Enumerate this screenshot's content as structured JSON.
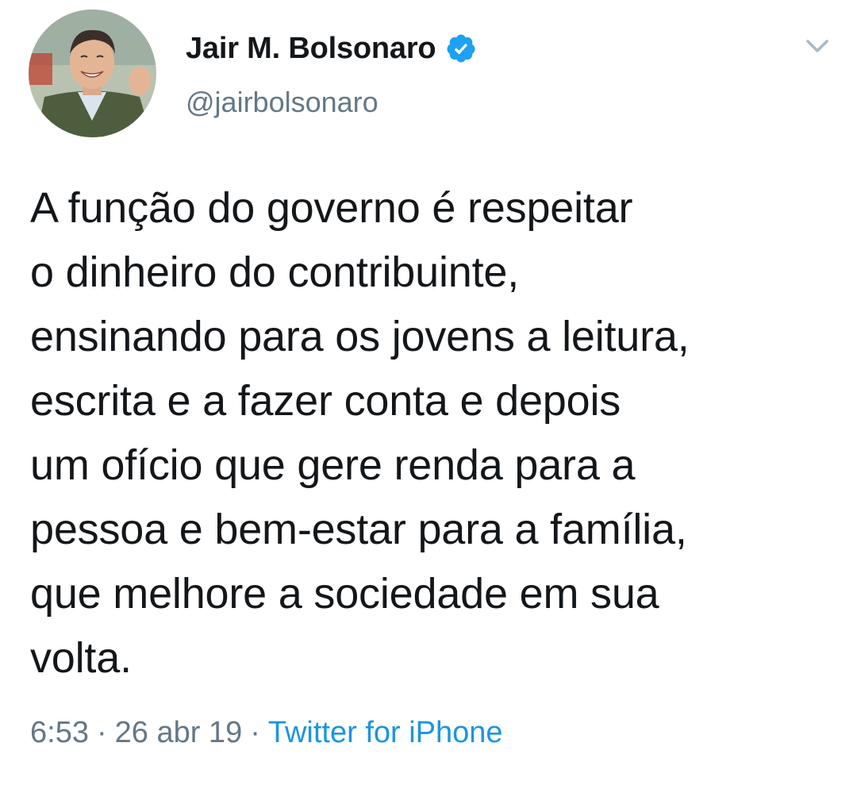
{
  "tweet": {
    "author": {
      "display_name": "Jair M. Bolsonaro",
      "handle": "@jairbolsonaro",
      "verified": true,
      "avatar_icon": "profile-photo"
    },
    "text": "A função do governo é respeitar\no dinheiro do contribuinte,\nensinando para os jovens a leitura,\nescrita e a fazer conta e depois\num ofício que gere renda para a\npessoa e bem-estar para a família,\nque melhore a sociedade em sua\nvolta.",
    "time": "6:53",
    "date": "26 abr 19",
    "separator": "·",
    "source": "Twitter for iPhone"
  },
  "icons": {
    "verified": "verified-badge-icon",
    "menu": "chevron-down-icon"
  },
  "colors": {
    "text": "#14171a",
    "secondary": "#657786",
    "link": "#1b95e0",
    "verified": "#1da1f2",
    "background": "#ffffff"
  }
}
